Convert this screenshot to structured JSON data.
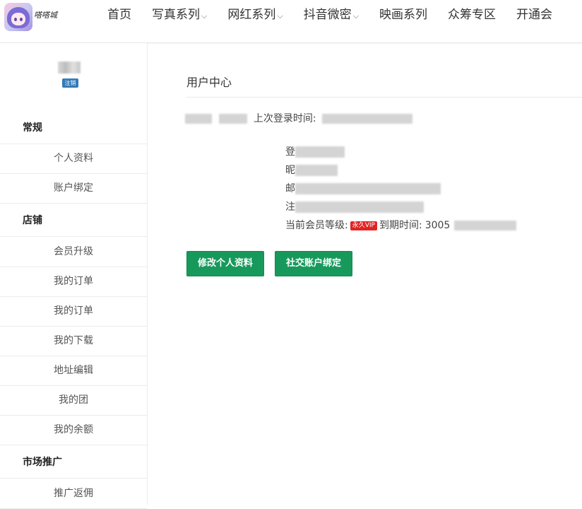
{
  "brand": {
    "logo_text": "嗒嗒城"
  },
  "nav": {
    "items": [
      {
        "label": "首页",
        "dropdown": false
      },
      {
        "label": "写真系列",
        "dropdown": true
      },
      {
        "label": "网红系列",
        "dropdown": true
      },
      {
        "label": "抖音微密",
        "dropdown": true
      },
      {
        "label": "映画系列",
        "dropdown": false
      },
      {
        "label": "众筹专区",
        "dropdown": false
      },
      {
        "label": "开通会",
        "dropdown": false
      }
    ],
    "chevron": "⌵"
  },
  "sidebar": {
    "logout_label": "注销",
    "sections": [
      {
        "title": "常规",
        "items": [
          "个人资料",
          "账户绑定"
        ]
      },
      {
        "title": "店铺",
        "items": [
          "会员升级",
          "我的订单",
          "我的订单",
          "我的下载",
          "地址编辑",
          "我的团",
          "我的余额"
        ]
      },
      {
        "title": "市场推广",
        "items": [
          "推广返佣"
        ]
      }
    ]
  },
  "main": {
    "title": "用户中心",
    "last_login_label": "上次登录时间:",
    "fields": {
      "login": "登",
      "nickname": "昵",
      "email": "邮",
      "register": "注"
    },
    "member_level_label": "当前会员等级:",
    "vip_badge": "永久VIP",
    "expire_label": "到期时间:",
    "expire_value": "3005",
    "buttons": {
      "edit_profile": "修改个人资料",
      "social_bind": "社交账户绑定"
    }
  },
  "colors": {
    "accent_green": "#17995b",
    "vip_red": "#e02424",
    "badge_blue": "#337ab7"
  }
}
